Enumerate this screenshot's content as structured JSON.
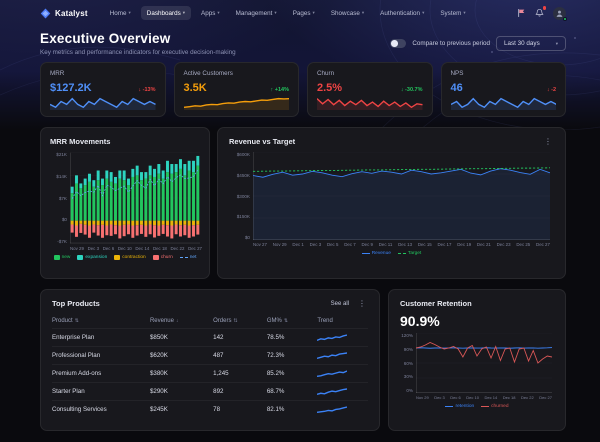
{
  "icons": {
    "chevron_down": "▾",
    "kebab": "⋮"
  },
  "nav": {
    "brand": "Katalyst",
    "items": [
      {
        "label": "Home"
      },
      {
        "label": "Dashboards"
      },
      {
        "label": "Apps"
      },
      {
        "label": "Management"
      },
      {
        "label": "Pages"
      },
      {
        "label": "Showcase"
      },
      {
        "label": "Authentication"
      },
      {
        "label": "System"
      }
    ]
  },
  "header": {
    "title": "Executive Overview",
    "subtitle": "Key metrics and performance indicators for executive decision-making",
    "compare_label": "Compare to previous period",
    "period_selected": "Last 30 days",
    "compare_toggle_state": "off"
  },
  "kpis": [
    {
      "label": "MRR",
      "value": "$127.2K",
      "value_color": "#4f8ff7",
      "delta": "↓ -13%",
      "delta_color": "#ef4444",
      "spark_color": "#4f8ff7",
      "spark": [
        100,
        99,
        101,
        100,
        102,
        100,
        99,
        101,
        100,
        102,
        101,
        100,
        99,
        101,
        100,
        102,
        101,
        100,
        101,
        100
      ]
    },
    {
      "label": "Active Customers",
      "value": "3.5K",
      "value_color": "#f59e0b",
      "delta": "↑ +14%",
      "delta_color": "#22c55e",
      "spark_color": "#f59e0b",
      "spark": [
        3.2,
        3.22,
        3.25,
        3.24,
        3.28,
        3.3,
        3.29,
        3.33,
        3.35,
        3.34,
        3.38,
        3.4,
        3.39,
        3.42,
        3.45,
        3.44,
        3.47,
        3.5,
        3.49,
        3.5
      ]
    },
    {
      "label": "Churn",
      "value": "2.5%",
      "value_color": "#ef4444",
      "delta": "↓ -30.7%",
      "delta_color": "#22c55e",
      "spark_color": "#ef4444",
      "spark": [
        3.2,
        2.6,
        3.1,
        2.5,
        3.0,
        2.4,
        2.9,
        2.5,
        3.0,
        2.4,
        2.8,
        2.3,
        2.9,
        2.4,
        2.8,
        2.3,
        2.7,
        2.2,
        2.6,
        2.5
      ]
    },
    {
      "label": "NPS",
      "value": "46",
      "value_color": "#4f8ff7",
      "delta": "↓ -2",
      "delta_color": "#ef4444",
      "spark_color": "#4f8ff7",
      "spark": [
        46,
        47,
        45,
        46,
        48,
        46,
        45,
        47,
        46,
        48,
        47,
        46,
        45,
        47,
        46,
        48,
        47,
        46,
        47,
        46
      ]
    }
  ],
  "chart_data": [
    {
      "id": "mrr-movements",
      "type": "bar",
      "title": "MRR Movements",
      "ylim": [
        -7,
        21
      ],
      "y_ticks": [
        "$21K",
        "$14K",
        "$7K",
        "$0",
        "-$7K"
      ],
      "x_ticks": [
        "Nov 29",
        "Dec 3",
        "Dec 6",
        "Dec 10",
        "Dec 14",
        "Dec 18",
        "Dec 22",
        "Dec 27"
      ],
      "series": [
        {
          "name": "new",
          "render": "bar",
          "swatch": "box",
          "color": "#22c55e",
          "values": [
            8.5,
            11.5,
            10,
            11,
            12,
            10.5,
            12.5,
            11,
            13,
            12,
            11.5,
            13,
            12.5,
            11,
            13.5,
            14,
            12.5,
            13,
            14,
            13.5,
            14.5,
            13,
            15,
            14.5,
            15,
            16,
            14,
            15.5,
            15,
            17
          ]
        },
        {
          "name": "expansion",
          "render": "bar",
          "swatch": "box",
          "color": "#2dd4bf",
          "values": [
            2,
            2.5,
            1.5,
            2,
            2.5,
            2,
            3,
            2,
            2.5,
            3,
            2,
            2.5,
            3,
            2,
            2.5,
            3,
            2.5,
            2,
            3,
            2.5,
            3,
            2.5,
            3.5,
            3,
            2.5,
            3,
            3.5,
            3,
            3.5,
            3
          ]
        },
        {
          "name": "contraction",
          "render": "bar",
          "swatch": "box",
          "color": "#eab308",
          "values": [
            -1.2,
            -1.5,
            -1,
            -1.3,
            -1.5,
            -1.2,
            -1.4,
            -1.3,
            -1.5,
            -1.2,
            -1.4,
            -1.5,
            -1.3,
            -1.2,
            -1.5,
            -1.4,
            -1.3,
            -1.5,
            -1.2,
            -1.4,
            -1.5,
            -1.3,
            -1.4,
            -1.5,
            -1.2,
            -1.4,
            -1.3,
            -1.5,
            -1.4,
            -1.3
          ]
        },
        {
          "name": "churn",
          "render": "bar",
          "swatch": "box",
          "color": "#f87171",
          "values": [
            -2.5,
            -3.5,
            -2.8,
            -3,
            -3.8,
            -2.5,
            -3.2,
            -4,
            -3,
            -3.5,
            -2.8,
            -4,
            -3.5,
            -3,
            -3.8,
            -3.2,
            -2.8,
            -3.5,
            -3,
            -3.8,
            -3.2,
            -2.8,
            -3.5,
            -4,
            -3,
            -3.5,
            -3.2,
            -3.8,
            -3.5,
            -3
          ]
        },
        {
          "name": "net",
          "render": "line",
          "swatch": "line",
          "style": "dashed",
          "color": "#60a5fa",
          "values": [
            6.8,
            9.0,
            7.7,
            8.7,
            9.2,
            8.8,
            10.9,
            7.7,
            11.0,
            10.3,
            9.3,
            10.0,
            10.7,
            8.8,
            10.7,
            12.4,
            10.9,
            10.0,
            12.8,
            10.8,
            12.8,
            11.4,
            13.6,
            12.0,
            13.3,
            14.1,
            13.0,
            13.2,
            13.6,
            15.7
          ]
        }
      ]
    },
    {
      "id": "revenue-vs-target",
      "type": "line",
      "title": "Revenue vs Target",
      "ylim": [
        0,
        600
      ],
      "y_ticks": [
        "$600K",
        "$450K",
        "$300K",
        "$150K",
        "$0"
      ],
      "x_ticks": [
        "Nov 27",
        "Nov 29",
        "Dec 1",
        "Dec 3",
        "Dec 5",
        "Dec 7",
        "Dec 9",
        "Dec 11",
        "Dec 13",
        "Dec 15",
        "Dec 17",
        "Dec 19",
        "Dec 21",
        "Dec 23",
        "Dec 25",
        "Dec 27"
      ],
      "series": [
        {
          "name": "Revenue",
          "render": "line",
          "swatch": "line",
          "style": "solid",
          "color": "#3b82f6",
          "area_fill": "rgba(59,130,246,0.10)",
          "values": [
            440,
            428,
            448,
            462,
            442,
            450,
            468,
            458,
            442,
            432,
            452,
            466,
            455,
            470,
            462,
            450,
            476,
            466,
            450,
            458,
            470,
            482,
            456,
            444,
            470,
            486,
            476,
            460,
            448,
            482,
            458
          ]
        },
        {
          "name": "Target",
          "render": "line",
          "swatch": "line",
          "style": "dashed",
          "color": "#22c55e",
          "values": [
            468,
            469,
            470,
            470,
            471,
            472,
            473,
            474,
            474,
            475,
            476,
            477,
            478,
            478,
            479,
            480,
            481,
            482,
            482,
            483,
            484,
            485,
            486,
            486,
            487,
            488,
            489,
            490,
            490,
            491,
            492
          ]
        }
      ]
    },
    {
      "id": "customer-retention",
      "type": "line",
      "title": "Customer Retention",
      "headline_value": "90.9%",
      "ylim": [
        0,
        120
      ],
      "y_ticks": [
        "120%",
        "90%",
        "60%",
        "30%",
        "0%"
      ],
      "x_ticks": [
        "Nov 29",
        "Dec 3",
        "Dec 6",
        "Dec 10",
        "Dec 14",
        "Dec 18",
        "Dec 22",
        "Dec 27"
      ],
      "series": [
        {
          "name": "retention",
          "render": "line",
          "swatch": "line",
          "style": "solid",
          "color": "#3b82f6",
          "values": [
            90,
            90.5,
            90,
            89.5,
            90,
            90.2,
            89.8,
            90,
            90.3,
            90,
            89.7,
            90,
            90.2,
            89.8,
            90,
            90.5,
            90,
            89.8,
            90.2,
            90,
            89.5,
            90,
            90.3,
            89.8,
            90,
            90.2,
            89.7,
            90,
            90.3,
            90.9
          ]
        },
        {
          "name": "churned",
          "render": "line",
          "swatch": "line",
          "style": "solid",
          "color": "#d95757",
          "values": [
            90,
            92,
            96,
            101,
            97,
            92,
            88,
            90,
            93,
            88,
            72,
            90,
            95,
            74,
            88,
            92,
            70,
            93,
            65,
            88,
            90,
            62,
            88,
            90,
            64,
            85,
            60,
            68,
            74,
            72
          ]
        }
      ]
    }
  ],
  "products": {
    "title": "Top Products",
    "see_all": "See all",
    "trend_color": "#3b82f6",
    "columns": [
      {
        "label": "Product",
        "sort": "⇅"
      },
      {
        "label": "Revenue",
        "sort": "↓"
      },
      {
        "label": "Orders",
        "sort": "⇅"
      },
      {
        "label": "GM%",
        "sort": "⇅"
      },
      {
        "label": "Trend",
        "sort": ""
      }
    ],
    "rows": [
      {
        "product": "Enterprise Plan",
        "revenue": "$850K",
        "orders": "142",
        "gm": "78.5%",
        "trend": [
          2,
          2.3,
          2.2,
          2.5,
          2.4,
          2.7,
          2.6,
          2.9,
          3.1
        ]
      },
      {
        "product": "Professional Plan",
        "revenue": "$620K",
        "orders": "487",
        "gm": "72.3%",
        "trend": [
          2,
          2.2,
          2.4,
          2.3,
          2.6,
          2.5,
          2.8,
          2.9,
          3.0
        ]
      },
      {
        "product": "Premium Add-ons",
        "revenue": "$380K",
        "orders": "1,245",
        "gm": "85.2%",
        "trend": [
          2,
          2.1,
          2.3,
          2.5,
          2.4,
          2.6,
          2.8,
          2.7,
          3.0
        ]
      },
      {
        "product": "Starter Plan",
        "revenue": "$290K",
        "orders": "892",
        "gm": "68.7%",
        "trend": [
          2,
          2.2,
          2.1,
          2.4,
          2.6,
          2.5,
          2.7,
          2.9,
          3.0
        ]
      },
      {
        "product": "Consulting Services",
        "revenue": "$245K",
        "orders": "78",
        "gm": "82.1%",
        "trend": [
          2,
          2.1,
          2.2,
          2.4,
          2.3,
          2.6,
          2.7,
          2.9,
          3.1
        ]
      }
    ]
  }
}
